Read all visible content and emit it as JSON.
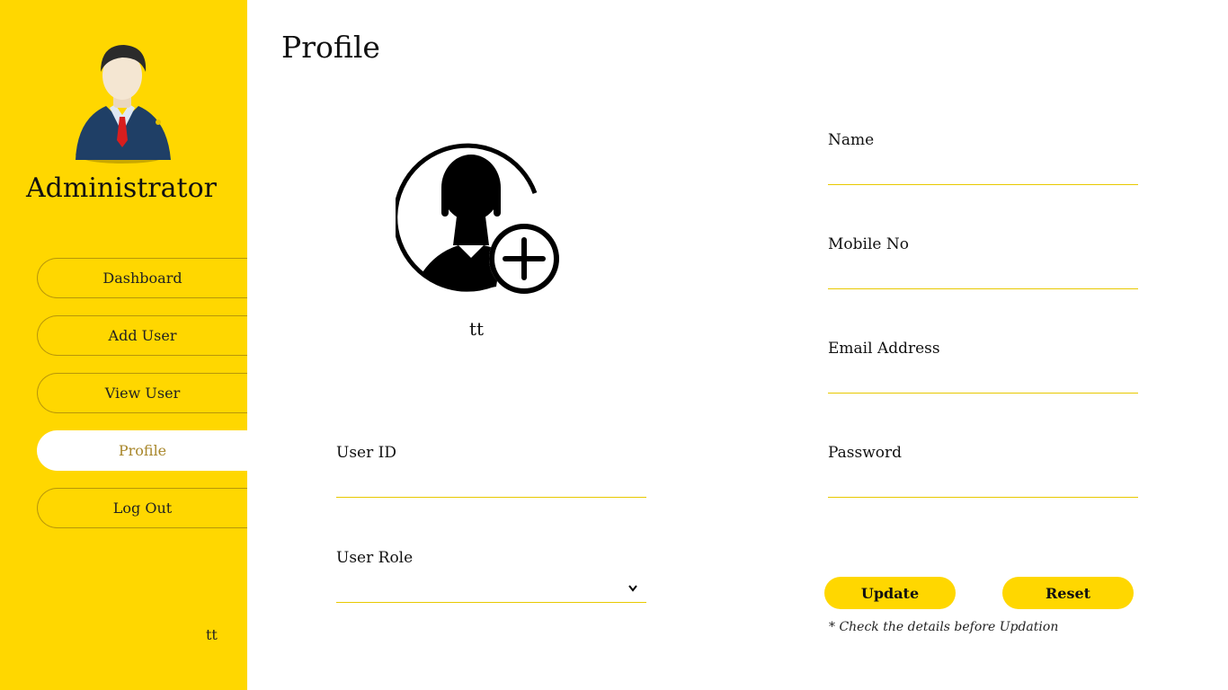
{
  "sidebar": {
    "role_title": "Administrator",
    "items": [
      {
        "label": "Dashboard"
      },
      {
        "label": "Add User"
      },
      {
        "label": "View User"
      },
      {
        "label": "Profile",
        "active": true
      },
      {
        "label": "Log Out"
      }
    ],
    "username": "tt"
  },
  "main": {
    "title": "Profile",
    "profile_name": "tt",
    "fields": {
      "user_id": {
        "label": "User ID",
        "value": ""
      },
      "user_role": {
        "label": "User Role",
        "value": ""
      },
      "name": {
        "label": "Name",
        "value": ""
      },
      "mobile": {
        "label": "Mobile No",
        "value": ""
      },
      "email": {
        "label": "Email Address",
        "value": ""
      },
      "password": {
        "label": "Password",
        "value": ""
      }
    },
    "buttons": {
      "update": "Update",
      "reset": "Reset"
    },
    "note": "* Check the details before Updation"
  },
  "colors": {
    "accent": "#ffd700",
    "active_text": "#a8862a",
    "line": "#e8c900"
  },
  "icons": {
    "avatar": "admin-avatar-icon",
    "photo": "add-profile-photo-icon",
    "chevron": "chevron-down-icon"
  }
}
